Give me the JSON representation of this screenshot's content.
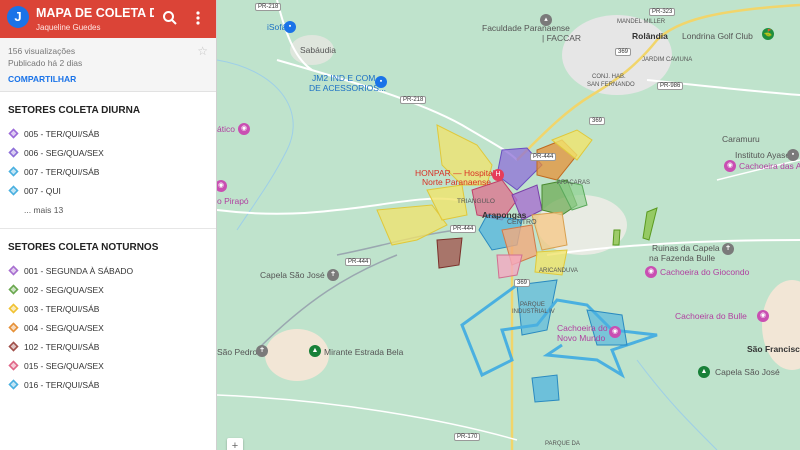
{
  "header": {
    "avatar_letter": "J",
    "title": "MAPA DE COLETA DO…",
    "author": "Jaqueline Guedes",
    "bg_color": "#db4437"
  },
  "meta": {
    "views": "156 visualizações",
    "published": "Publicado há 2 dias",
    "share_label": "COMPARTILHAR"
  },
  "layers": [
    {
      "title": "SETORES COLETA DIURNA",
      "items": [
        {
          "label": "005 - TER/QUI/SÁB",
          "color": "#9c6ad9"
        },
        {
          "label": "006 - SEG/QUA/SEX",
          "color": "#8e6fd8"
        },
        {
          "label": "007 - TER/QUI/SÁB",
          "color": "#4ab0e0"
        },
        {
          "label": "007 - QUI",
          "color": "#4ab0e0"
        }
      ],
      "more": "... mais 13"
    },
    {
      "title": "SETORES COLETA NOTURNOS",
      "items": [
        {
          "label": "001 - SEGUNDA À SÁBADO",
          "color": "#a86fd0"
        },
        {
          "label": "002 - SEG/QUA/SEX",
          "color": "#6aa84f"
        },
        {
          "label": "003 - TER/QUI/SÁB",
          "color": "#f1c232"
        },
        {
          "label": "004 - SEG/QUA/SEX",
          "color": "#e69138"
        },
        {
          "label": "102 - TER/QUI/SÁB",
          "color": "#a0504a"
        },
        {
          "label": "015 - SEG/QUA/SEX",
          "color": "#e06688"
        },
        {
          "label": "016 - TER/QUI/SÁB",
          "color": "#4ab0e0"
        }
      ]
    }
  ],
  "map": {
    "labels": {
      "isofa": "iSofá",
      "sabaudia": "Sabáudia",
      "jm2_1": "JM2 IND E COM",
      "jm2_2": "DE ACESSORIOS...",
      "faculdade_1": "Faculdade Paranaense",
      "faculdade_2": "| FACCAR",
      "rolandia": "Rolândia",
      "golf": "Londrina Golf Club",
      "mandel": "MANDEL MILLER",
      "jardim": "JARDIM CAVIUNA",
      "conj": "CONJ. HAB.",
      "sanfer": "SAN FERNANDO",
      "caramuru": "Caramuru",
      "ayaser": "Instituto Ayaser",
      "abelhas": "Cachoeira das Abelh",
      "atico": "ático",
      "pirapo": "o Pirapó",
      "honpar1": "HONPAR — Hospital",
      "honpar2": "Norte Paranaense",
      "triangulo": "TRIANGULO",
      "arapongas": "Arapongas",
      "centro": "CENTRO",
      "capela_sj": "Capela São José",
      "ruinas1": "Ruinas da Capela",
      "ruinas2": "na Fazenda Bulle",
      "giocondo": "Cachoeira do Giocondo",
      "bulle": "Cachoeira do Bulle",
      "novo1": "Cachoeira do",
      "novo2": "Novo Mundo",
      "sao_pedro": "São Pedro",
      "mirante": "Mirante Estrada Bela",
      "sao_francisco": "São Francisco",
      "capela_sj2": "Capela São José",
      "parque_ind": "PARQUE",
      "parque_ind2": "INDUSTRIAL IV",
      "parque_da": "PARQUE DA",
      "arica": "ARICANDUVA",
      "aracaras": "ARAÇARAS"
    },
    "roads": {
      "pr218a": "PR-218",
      "pr218b": "PR-218",
      "pr323": "PR-323",
      "br369a": "369",
      "br369b": "369",
      "pr986": "PR-986",
      "pr444a": "PR-444",
      "pr444b": "PR-444",
      "pr444c": "PR-444",
      "br369c": "369",
      "pr170": "PR-170"
    },
    "zoom_label": "+"
  }
}
